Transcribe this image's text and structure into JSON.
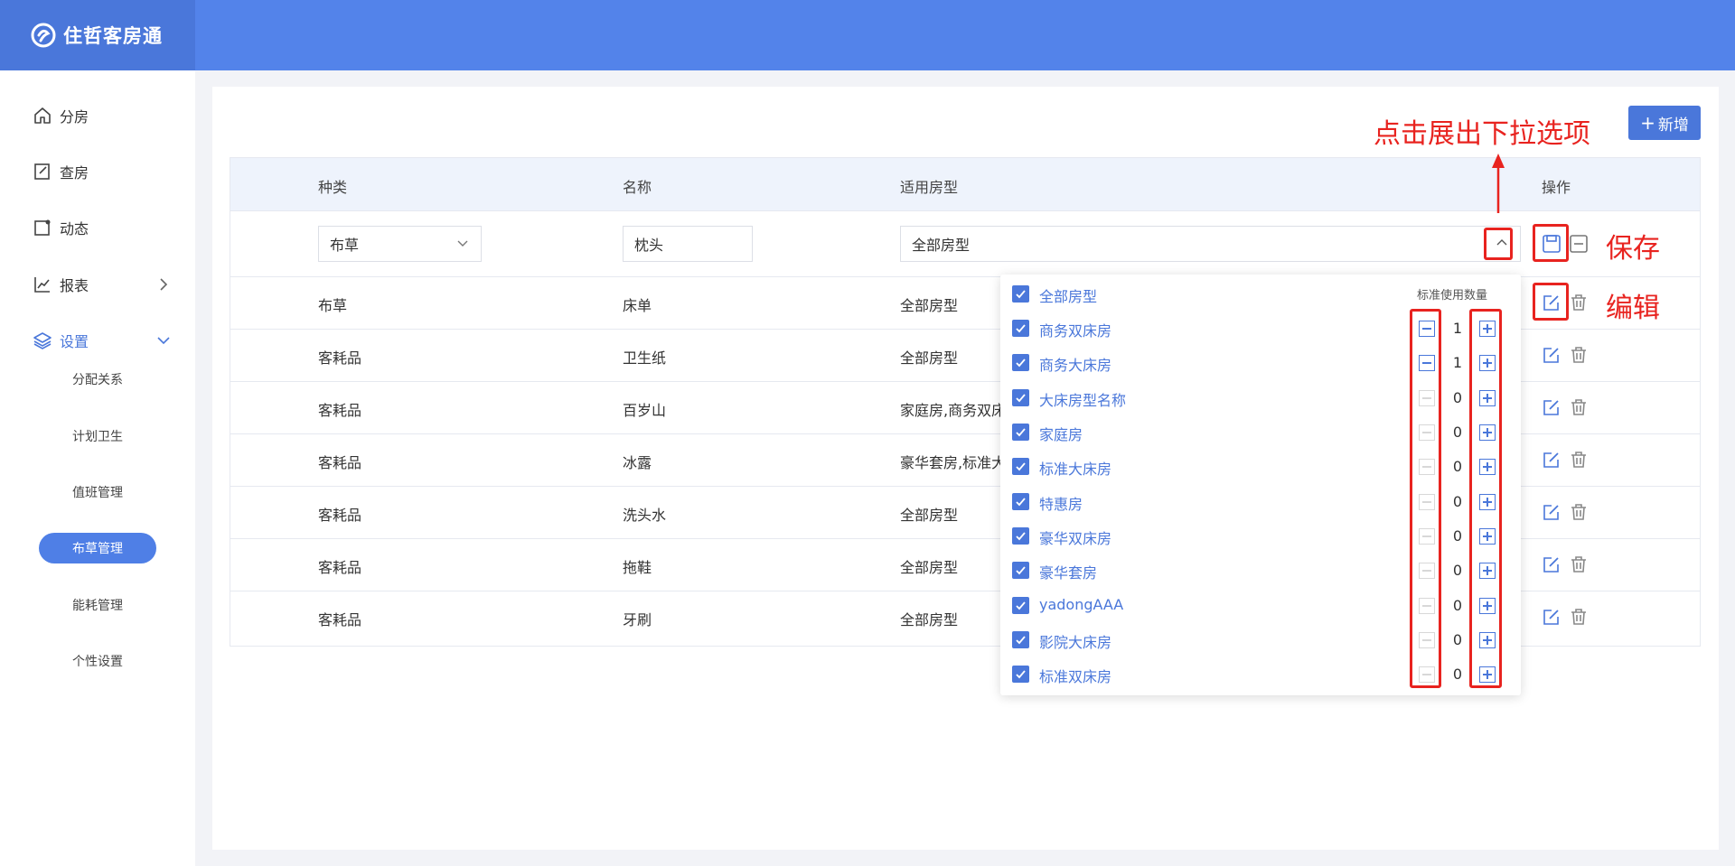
{
  "app": {
    "title": "住哲客房通"
  },
  "sidebar": {
    "items": [
      {
        "label": "分房",
        "icon": "home-icon"
      },
      {
        "label": "查房",
        "icon": "edit-doc-icon"
      },
      {
        "label": "动态",
        "icon": "notification-icon"
      },
      {
        "label": "报表",
        "icon": "chart-icon"
      },
      {
        "label": "设置",
        "icon": "layers-icon"
      }
    ],
    "sub_items": [
      {
        "label": "分配关系"
      },
      {
        "label": "计划卫生"
      },
      {
        "label": "值班管理"
      },
      {
        "label": "布草管理"
      },
      {
        "label": "能耗管理"
      },
      {
        "label": "个性设置"
      }
    ],
    "active_sub": "布草管理"
  },
  "toolbar": {
    "add_label": "新增"
  },
  "table": {
    "headers": [
      "种类",
      "名称",
      "适用房型",
      "操作"
    ],
    "edit_row": {
      "category": "布草",
      "name": "枕头",
      "room_types": "全部房型"
    },
    "rows": [
      {
        "category": "布草",
        "name": "床单",
        "room_types": "全部房型"
      },
      {
        "category": "客耗品",
        "name": "卫生纸",
        "room_types": "全部房型"
      },
      {
        "category": "客耗品",
        "name": "百岁山",
        "room_types": "家庭房,商务双床"
      },
      {
        "category": "客耗品",
        "name": "冰露",
        "room_types": "豪华套房,标准大"
      },
      {
        "category": "客耗品",
        "name": "洗头水",
        "room_types": "全部房型"
      },
      {
        "category": "客耗品",
        "name": "拖鞋",
        "room_types": "全部房型"
      },
      {
        "category": "客耗品",
        "name": "牙刷",
        "room_types": "全部房型"
      }
    ]
  },
  "dropdown": {
    "header": "标准使用数量",
    "options": [
      {
        "label": "全部房型",
        "checked": true
      },
      {
        "label": "商务双床房",
        "checked": true,
        "count": "1"
      },
      {
        "label": "商务大床房",
        "checked": true,
        "count": "1"
      },
      {
        "label": "大床房型名称",
        "checked": true,
        "count": "0"
      },
      {
        "label": "家庭房",
        "checked": true,
        "count": "0"
      },
      {
        "label": "标准大床房",
        "checked": true,
        "count": "0"
      },
      {
        "label": "特惠房",
        "checked": true,
        "count": "0"
      },
      {
        "label": "豪华双床房",
        "checked": true,
        "count": "0"
      },
      {
        "label": "豪华套房",
        "checked": true,
        "count": "0"
      },
      {
        "label": "yadongAAA",
        "checked": true,
        "count": "0"
      },
      {
        "label": "影院大床房",
        "checked": true,
        "count": "0"
      },
      {
        "label": "标准双床房",
        "checked": true,
        "count": "0"
      }
    ]
  },
  "annotations": {
    "dropdown_hint": "点击展出下拉选项",
    "save": "保存",
    "edit": "编辑"
  },
  "colors": {
    "primary": "#4a77da",
    "topbar": "#5383ea",
    "annotation": "#e8231f"
  }
}
